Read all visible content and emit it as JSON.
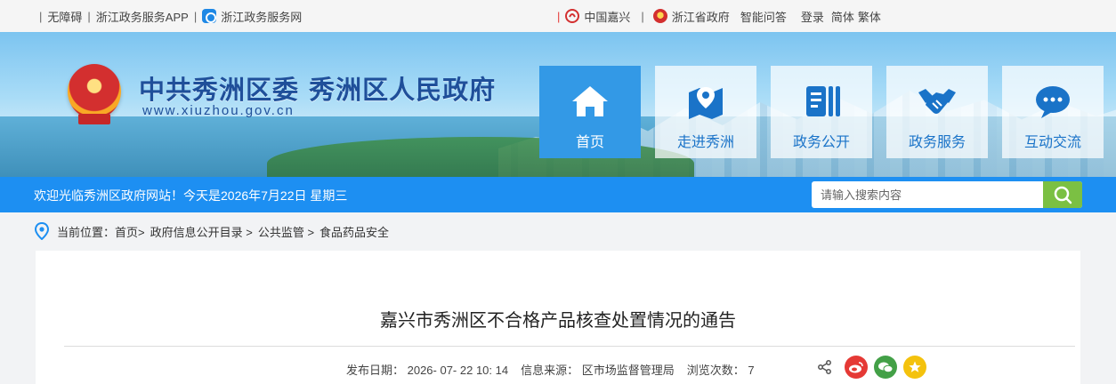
{
  "topbar": {
    "accessibility": "无障碍",
    "app": "浙江政务服务APP",
    "service_net": "浙江政务服务网",
    "jiaxing": "中国嘉兴",
    "zhejiang": "浙江省政府",
    "qa": "智能问答",
    "login": "登录",
    "simplified": "简体",
    "traditional": "繁体",
    "separator": "|"
  },
  "header": {
    "title": "中共秀洲区委 秀洲区人民政府",
    "url": "www.xiuzhou.gov.cn"
  },
  "nav": [
    {
      "label": "首页",
      "icon": "home-icon",
      "active": true
    },
    {
      "label": "走进秀洲",
      "icon": "map-pin-icon",
      "active": false
    },
    {
      "label": "政务公开",
      "icon": "document-icon",
      "active": false
    },
    {
      "label": "政务服务",
      "icon": "handshake-icon",
      "active": false
    },
    {
      "label": "互动交流",
      "icon": "chat-icon",
      "active": false
    }
  ],
  "welcome": {
    "text": "欢迎光临秀洲区政府网站！今天是2026年7月22日 星期三",
    "search_placeholder": "请输入搜索内容"
  },
  "breadcrumb": {
    "label": "当前位置：",
    "items": [
      "首页>",
      "政府信息公开目录 >",
      "公共监管 >",
      "食品药品安全"
    ]
  },
  "article": {
    "title": "嘉兴市秀洲区不合格产品核查处置情况的通告",
    "publish_date": "发布日期： 2026- 07- 22 10: 14",
    "source": "信息来源： 区市场监督管理局",
    "views": "浏览次数： 7"
  },
  "colors": {
    "accent_blue": "#1d8ff2",
    "nav_active": "#3399e6",
    "title_blue": "#1f4f9a",
    "search_green": "#7bc043",
    "weibo_red": "#e53935",
    "wechat_green": "#43a047",
    "favorite_yellow": "#f4c20d"
  }
}
